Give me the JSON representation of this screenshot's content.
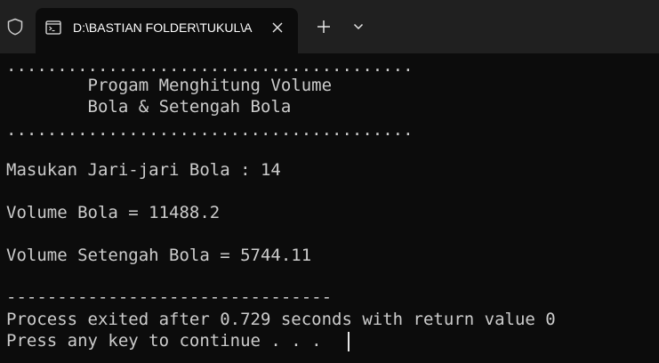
{
  "tab": {
    "title": "D:\\BASTIAN FOLDER\\TUKUL\\A",
    "icon": "terminal-icon"
  },
  "titlebar_icons": {
    "shield": "shield-icon",
    "close": "close-icon",
    "new_tab": "plus-icon",
    "dropdown": "chevron-down-icon"
  },
  "console": {
    "lines": [
      "........................................",
      "        Progam Menghitung Volume",
      "        Bola & Setengah Bola",
      "........................................",
      "Masukan Jari-jari Bola : 14",
      "Volume Bola = 11488.2",
      "Volume Setengah Bola = 5744.11",
      "--------------------------------",
      "Process exited after 0.729 seconds with return value 0",
      "Press any key to continue . . ."
    ]
  },
  "colors": {
    "background": "#0c0c0c",
    "tabbar": "#202020",
    "text": "#cccccc"
  }
}
